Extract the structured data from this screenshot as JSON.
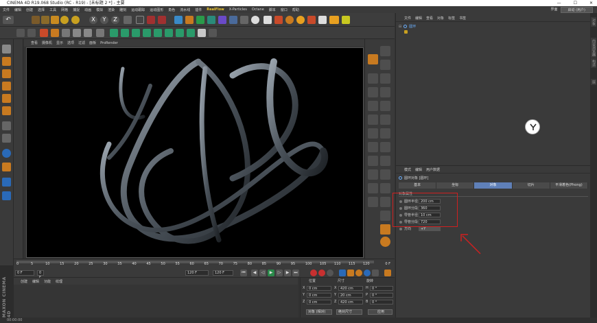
{
  "titlebar": {
    "text": "CINEMA 4D R19.068 Studio (RC - R19) - [未标题 2 *] - 主要"
  },
  "menubar": {
    "items": [
      "文件",
      "编辑",
      "创建",
      "选择",
      "工具",
      "网格",
      "捕捉",
      "动画",
      "模拟",
      "渲染",
      "雕刻",
      "运动跟踪",
      "运动图形",
      "角色",
      "流水线",
      "插件",
      "RealFlow",
      "X-Particles",
      "Octane",
      "脚本",
      "窗口",
      "帮助"
    ],
    "highlight_index": 16,
    "layout_label": "界面",
    "layout_value": "启动 (用户)"
  },
  "toolbar": {
    "undo_label": "↶"
  },
  "viewport_menu": [
    "查看",
    "摄像机",
    "显示",
    "选项",
    "过滤",
    "面板",
    "ProRender"
  ],
  "timeline": {
    "ticks": [
      "0",
      "5",
      "10",
      "15",
      "20",
      "25",
      "30",
      "35",
      "40",
      "45",
      "50",
      "55",
      "60",
      "65",
      "70",
      "75",
      "80",
      "85",
      "90",
      "95",
      "100",
      "105",
      "110",
      "115",
      "120"
    ],
    "end_label": "0 F"
  },
  "playbar": {
    "start_field": "0 F",
    "current_field": "0 F",
    "end_field": "120 F",
    "max_field": "120 F"
  },
  "material_menu": [
    "创建",
    "编辑",
    "功能",
    "纹理"
  ],
  "coordinates": {
    "col_position": "位置",
    "col_size": "尺寸",
    "col_rotation": "旋转",
    "rows": [
      {
        "axis": "X",
        "pos": "0 cm",
        "size_axis": "X",
        "size": "420 cm",
        "rot_axis": "H",
        "rot": "0 °"
      },
      {
        "axis": "Y",
        "pos": "0 cm",
        "size_axis": "Y",
        "size": "20 cm",
        "rot_axis": "P",
        "rot": "0 °"
      },
      {
        "axis": "Z",
        "pos": "0 cm",
        "size_axis": "Z",
        "size": "420 cm",
        "rot_axis": "B",
        "rot": "0 °"
      }
    ],
    "mode_select": "对象 (相对)",
    "size_select": "绝对尺寸",
    "apply_button": "应用"
  },
  "object_panel": {
    "menu": [
      "文件",
      "编辑",
      "查看",
      "对象",
      "标签",
      "书签"
    ],
    "tree_item": "圆环"
  },
  "attribute_panel": {
    "menu": [
      "模式",
      "编辑",
      "用户数据"
    ],
    "title": "圆环对象 [圆环]",
    "tabs": [
      "基本",
      "坐标",
      "对象",
      "切片",
      "平滑着色(Phong)"
    ],
    "active_tab": 2,
    "section": "对象属性",
    "props": [
      {
        "label": "圆环半径",
        "value": "200 cm"
      },
      {
        "label": "圆环分段",
        "value": "360"
      },
      {
        "label": "导管半径",
        "value": "10 cm"
      },
      {
        "label": "导管分段",
        "value": "720"
      },
      {
        "label": "方向",
        "value": "+Y"
      }
    ]
  },
  "statusbar": {
    "text": "00:00:00"
  },
  "brand": {
    "vertical": "MAXON CINEMA 4D"
  },
  "right_strip": {
    "tabs": [
      "对象",
      "内容浏览器",
      "构造",
      "层"
    ]
  },
  "colors": {
    "accent_tab": "#5f80b8",
    "highlight_box": "#d02020",
    "menu_highlight": "#f0c830"
  }
}
